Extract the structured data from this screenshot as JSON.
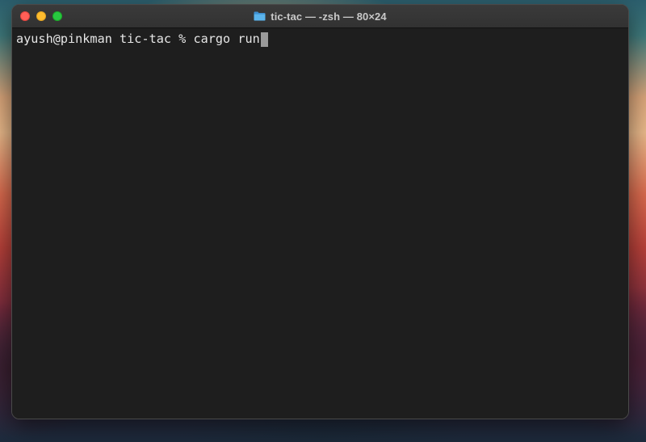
{
  "window": {
    "title": "tic-tac — -zsh — 80×24",
    "title_icon": "folder-icon"
  },
  "terminal": {
    "prompt": "ayush@pinkman tic-tac % ",
    "command": "cargo run"
  },
  "colors": {
    "close": "#ff5f57",
    "minimize": "#febc2e",
    "maximize": "#28c840",
    "terminal_bg": "#1e1e1e",
    "text": "#e6e6e6",
    "folder": "#4aa3df"
  }
}
